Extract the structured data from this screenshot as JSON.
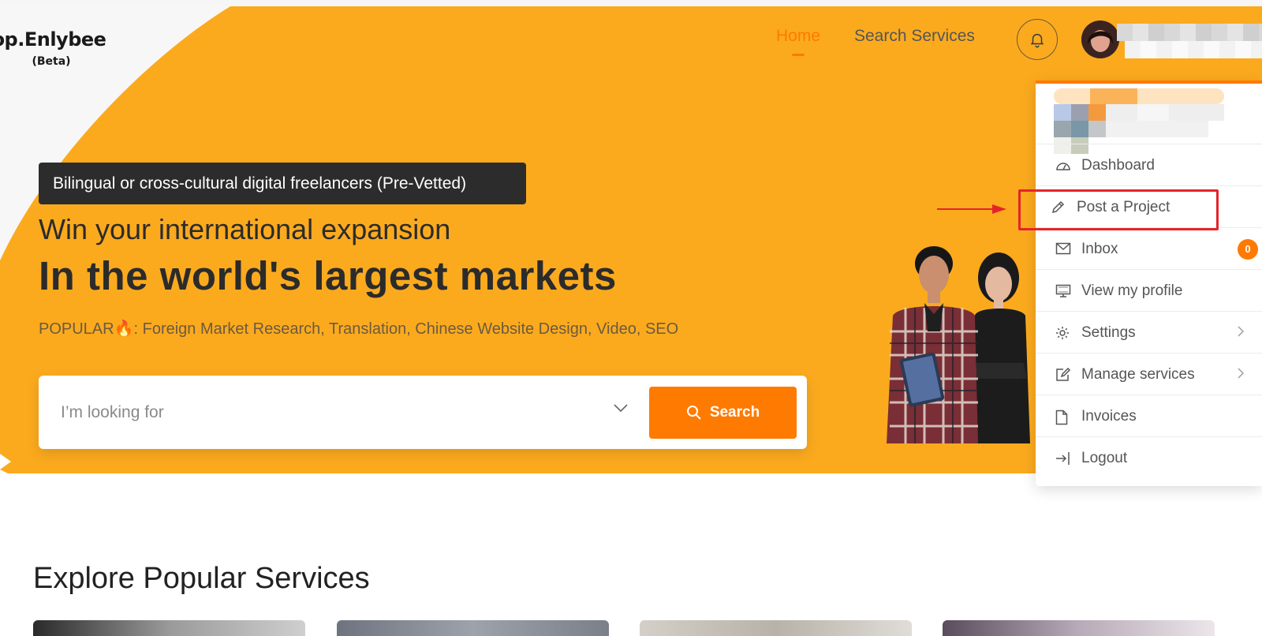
{
  "brand": {
    "logo": "op.Enlybee",
    "sub": "(Beta)"
  },
  "nav": {
    "home": "Home",
    "search_services": "Search Services"
  },
  "hero": {
    "badge": "Bilingual or cross-cultural digital freelancers (Pre-Vetted)",
    "subtitle": "Win your international expansion",
    "title": "In the world's largest markets",
    "popular": "POPULAR🔥: Foreign Market Research, Translation, Chinese Website Design, Video, SEO"
  },
  "search": {
    "placeholder": "I’m looking for",
    "button": "Search"
  },
  "section": {
    "title": "Explore Popular Services"
  },
  "user_menu": {
    "items": [
      {
        "label": "Dashboard",
        "icon": "dashboard-icon"
      },
      {
        "label": "Post a Project",
        "icon": "pencil-icon"
      },
      {
        "label": "Inbox",
        "icon": "envelope-icon",
        "badge": "0"
      },
      {
        "label": "View my profile",
        "icon": "monitor-icon"
      },
      {
        "label": "Settings",
        "icon": "gear-icon"
      },
      {
        "label": "Manage services",
        "icon": "edit-icon"
      },
      {
        "label": "Invoices",
        "icon": "document-icon"
      },
      {
        "label": "Logout",
        "icon": "logout-icon"
      }
    ]
  },
  "colors": {
    "accent": "#ff7a00",
    "hero": "#fbaa1e",
    "dark": "#2c2c2c",
    "highlight": "#e4242a"
  }
}
